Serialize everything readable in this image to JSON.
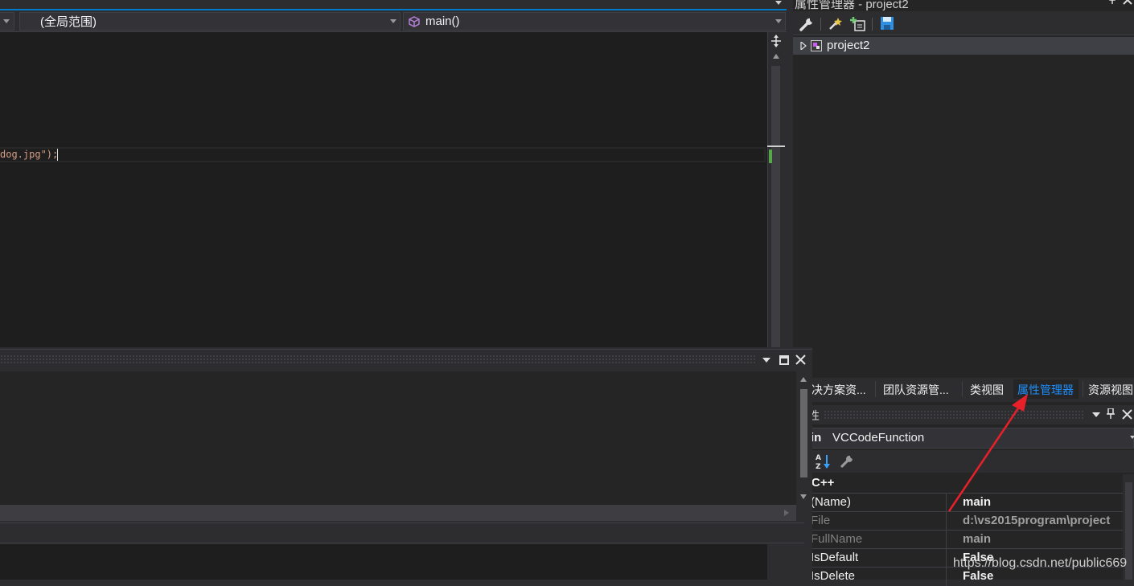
{
  "editor": {
    "scope_combo": "(全局范围)",
    "member_combo": "main()",
    "code_line": "dog.jpg\");"
  },
  "property_manager": {
    "title": "属性管理器 - project2",
    "project_node": "project2"
  },
  "tabs": [
    {
      "label": "决方案资..."
    },
    {
      "label": "团队资源管..."
    },
    {
      "label": "类视图"
    },
    {
      "label": "属性管理器",
      "active": true
    },
    {
      "label": "资源视图"
    }
  ],
  "properties": {
    "title": "性",
    "object_name": "in",
    "object_type": "VCCodeFunction",
    "category": "C++",
    "rows": [
      {
        "name": "(Name)",
        "value": "main"
      },
      {
        "name": "File",
        "value": "d:\\vs2015program\\project"
      },
      {
        "name": "FullName",
        "value": "main"
      },
      {
        "name": "IsDefault",
        "value": "False"
      },
      {
        "name": "IsDelete",
        "value": "False"
      }
    ]
  },
  "watermark": "https://blog.csdn.net/public669",
  "colors": {
    "accent": "#007acc",
    "active_tab": "#1e90ff",
    "annotation_arrow": "#e8202a"
  }
}
